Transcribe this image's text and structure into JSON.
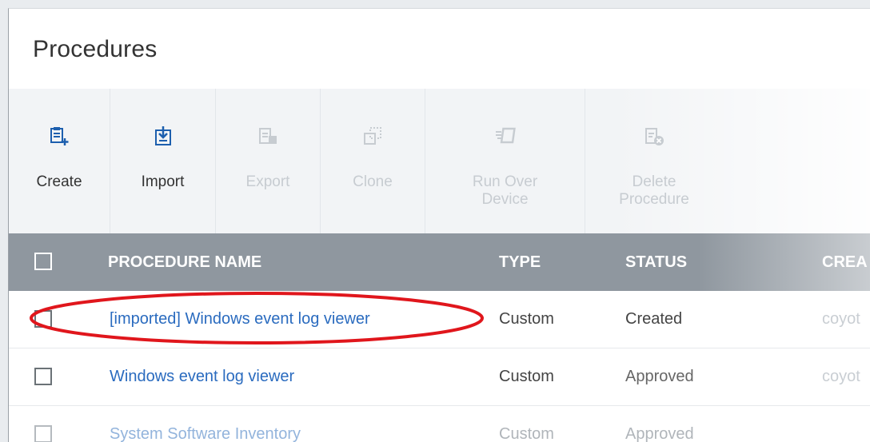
{
  "page": {
    "title": "Procedures"
  },
  "toolbar": {
    "buttons": [
      {
        "label": "Create",
        "icon": "create-procedure-icon",
        "enabled": true
      },
      {
        "label": "Import",
        "icon": "import-icon",
        "enabled": true
      },
      {
        "label": "Export",
        "icon": "export-icon",
        "enabled": false
      },
      {
        "label": "Clone",
        "icon": "clone-icon",
        "enabled": false
      },
      {
        "label": "Run Over Device",
        "icon": "run-over-device-icon",
        "enabled": false
      },
      {
        "label": "Delete Procedure",
        "icon": "delete-procedure-icon",
        "enabled": false
      }
    ]
  },
  "table": {
    "columns": [
      "PROCEDURE NAME",
      "TYPE",
      "STATUS",
      "CREA"
    ],
    "rows": [
      {
        "name": "[imported] Windows event log viewer",
        "type": "Custom",
        "status": "Created",
        "created_by": "coyot",
        "highlighted": true
      },
      {
        "name": "Windows event log viewer",
        "type": "Custom",
        "status": "Approved",
        "created_by": "coyot"
      },
      {
        "name": "System Software Inventory",
        "type": "Custom",
        "status": "Approved",
        "created_by": ""
      }
    ]
  },
  "colors": {
    "accent": "#2a6bbf",
    "header_bg": "#8f979f",
    "annotation": "#e0161c",
    "icon": "#1d5fae"
  }
}
